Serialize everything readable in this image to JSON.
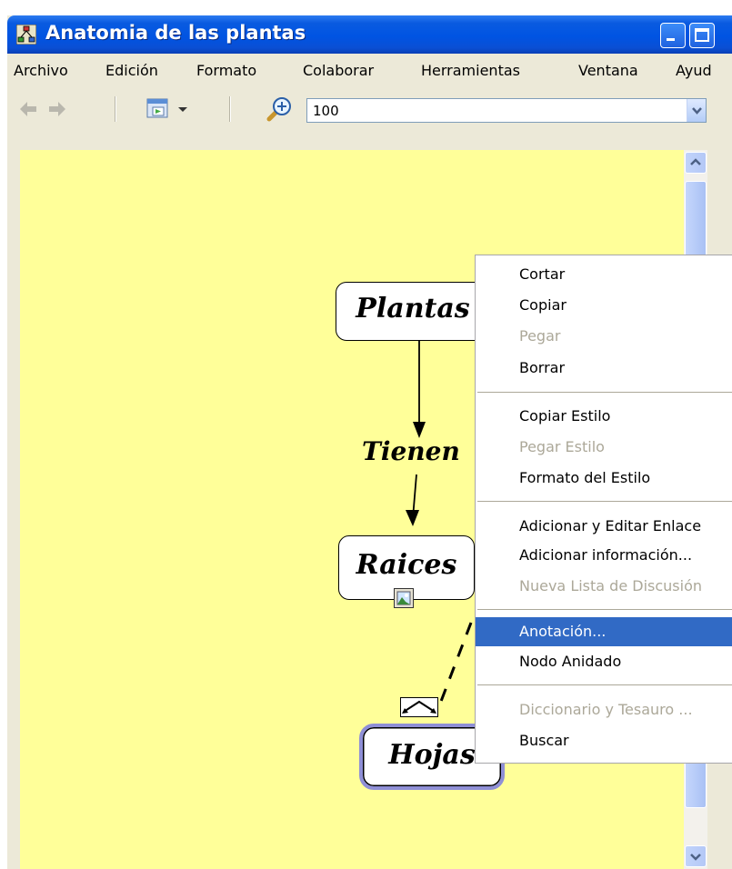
{
  "window": {
    "title": "Anatomia de las plantas"
  },
  "menubar": {
    "items": [
      "Archivo",
      "Edición",
      "Formato",
      "Colaborar",
      "Herramientas",
      "Ventana",
      "Ayud"
    ]
  },
  "toolbar": {
    "zoom_value": "100"
  },
  "map": {
    "nodes": {
      "plantas": "Plantas",
      "raices": "Raices",
      "hojas": "Hojas"
    },
    "link_label": "Tienen"
  },
  "context_menu": {
    "items": [
      {
        "label": "Cortar",
        "state": "enabled"
      },
      {
        "label": "Copiar",
        "state": "enabled"
      },
      {
        "label": "Pegar",
        "state": "disabled"
      },
      {
        "label": "Borrar",
        "state": "enabled"
      },
      {
        "label": "Copiar Estilo",
        "state": "enabled"
      },
      {
        "label": "Pegar Estilo",
        "state": "disabled"
      },
      {
        "label": "Formato del Estilo",
        "state": "enabled"
      },
      {
        "label": "Adicionar y Editar Enlace",
        "state": "enabled"
      },
      {
        "label": "Adicionar información...",
        "state": "enabled"
      },
      {
        "label": "Nueva Lista de Discusión",
        "state": "disabled"
      },
      {
        "label": "Anotación...",
        "state": "highlighted"
      },
      {
        "label": "Nodo Anidado",
        "state": "enabled"
      },
      {
        "label": "Diccionario y Tesauro ...",
        "state": "disabled"
      },
      {
        "label": "Buscar",
        "state": "enabled"
      }
    ]
  },
  "colors": {
    "canvas_background": "#ffff99",
    "title_bar": "#0054e3",
    "menu_highlight": "#316ac5",
    "disabled_text": "#aca899",
    "selected_node_border": "#8f8fd6"
  },
  "icons": [
    "app-icon",
    "minimize-icon",
    "maximize-icon",
    "back-arrow-icon",
    "forward-arrow-icon",
    "view-toggle-icon",
    "zoom-icon",
    "dropdown-arrow-icon",
    "scroll-up-icon",
    "scroll-down-icon",
    "image-resource-icon",
    "link-connector-icon"
  ]
}
